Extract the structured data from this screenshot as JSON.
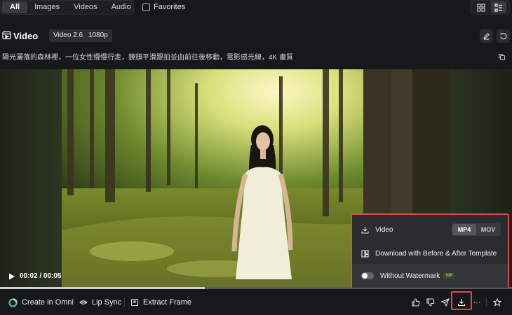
{
  "filters": {
    "tabs": [
      {
        "label": "All",
        "active": true
      },
      {
        "label": "Images",
        "active": false
      },
      {
        "label": "Videos",
        "active": false
      },
      {
        "label": "Audio",
        "active": false
      }
    ],
    "favorites_label": "Favorites",
    "favorites_checked": false
  },
  "view_toggle": {
    "grid_icon": "grid-icon",
    "list_icon": "list-icon",
    "active": "list"
  },
  "header": {
    "title": "Video",
    "chips": [
      "Video 2.6",
      "1080p"
    ]
  },
  "prompt": "陽光灑落的森林裡，一位女性慢慢行走，鏡頭平滑跟拍並由前往後移動，電影感光線，4K 畫質",
  "player": {
    "time": "00:02 / 00:05",
    "progress": 0.4
  },
  "download_menu": {
    "video_label": "Video",
    "formats": [
      {
        "label": "MP4",
        "active": true
      },
      {
        "label": "MOV",
        "active": false
      }
    ],
    "template_label": "Download with Before & After Template",
    "watermark_label": "Without Watermark",
    "watermark_on": false,
    "vip_badge": "VIP"
  },
  "bottom_bar": {
    "create_label": "Create in Omni",
    "lipsync_label": "Lip Sync",
    "extract_label": "Extract Frame",
    "more_label": "···"
  },
  "colors": {
    "background": "#17181b",
    "highlight": "#e24a4a",
    "vip_text": "#9edb5a"
  }
}
